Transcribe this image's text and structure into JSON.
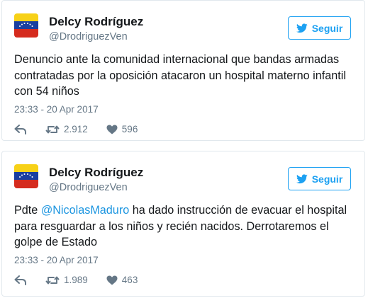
{
  "tweets": [
    {
      "name": "Delcy Rodríguez",
      "handle": "@DrodriguezVen",
      "follow_label": "Seguir",
      "text_before": "Denuncio ante la comunidad internacional que bandas armadas contratadas por la oposición atacaron un hospital materno infantil con 54 niños",
      "mention": "",
      "text_after": "",
      "date": "23:33 - 20 Apr 2017",
      "retweets": "2.912",
      "likes": "596"
    },
    {
      "name": "Delcy Rodríguez",
      "handle": "@DrodriguezVen",
      "follow_label": "Seguir",
      "text_before": "Pdte ",
      "mention": "@NicolasMaduro",
      "text_after": " ha dado instrucción de evacuar el hospital para resguardar a los niños y recién nacidos. Derrotaremos el golpe de Estado",
      "date": "23:33 - 20 Apr 2017",
      "retweets": "1.989",
      "likes": "463"
    }
  ],
  "colors": {
    "accent": "#1da1f2",
    "mention": "#1b95e0",
    "secondary_text": "#657786",
    "border": "#e1e8ed",
    "flag_yellow": "#f7d117",
    "flag_blue": "#1a3fa0",
    "flag_red": "#d52b1e"
  },
  "icons": [
    "venezuela-flag-avatar",
    "twitter-bird-icon",
    "reply-icon",
    "retweet-icon",
    "heart-icon"
  ]
}
